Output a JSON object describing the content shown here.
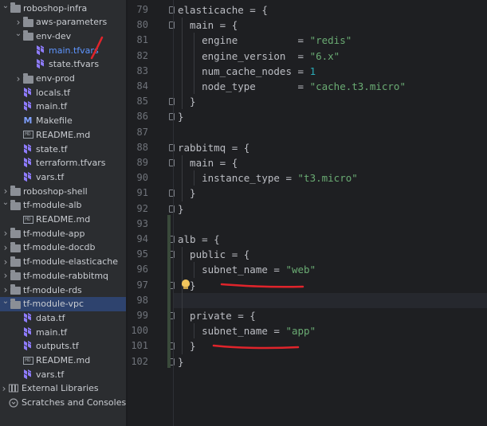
{
  "project_tree": {
    "items": [
      {
        "label": "roboshop-infra",
        "depth": 0,
        "kind": "folder",
        "expanded": true
      },
      {
        "label": "aws-parameters",
        "depth": 1,
        "kind": "folder",
        "expanded": false
      },
      {
        "label": "env-dev",
        "depth": 1,
        "kind": "folder",
        "expanded": true
      },
      {
        "label": "main.tfvars",
        "depth": 2,
        "kind": "terraform",
        "open": true
      },
      {
        "label": "state.tfvars",
        "depth": 2,
        "kind": "terraform"
      },
      {
        "label": "env-prod",
        "depth": 1,
        "kind": "folder",
        "expanded": false
      },
      {
        "label": "locals.tf",
        "depth": 1,
        "kind": "terraform"
      },
      {
        "label": "main.tf",
        "depth": 1,
        "kind": "terraform"
      },
      {
        "label": "Makefile",
        "depth": 1,
        "kind": "makefile"
      },
      {
        "label": "README.md",
        "depth": 1,
        "kind": "markdown"
      },
      {
        "label": "state.tf",
        "depth": 1,
        "kind": "terraform"
      },
      {
        "label": "terraform.tfvars",
        "depth": 1,
        "kind": "terraform"
      },
      {
        "label": "vars.tf",
        "depth": 1,
        "kind": "terraform"
      },
      {
        "label": "roboshop-shell",
        "depth": 0,
        "kind": "folder",
        "expanded": false
      },
      {
        "label": "tf-module-alb",
        "depth": 0,
        "kind": "folder",
        "expanded": true
      },
      {
        "label": "README.md",
        "depth": 1,
        "kind": "markdown"
      },
      {
        "label": "tf-module-app",
        "depth": 0,
        "kind": "folder",
        "expanded": false
      },
      {
        "label": "tf-module-docdb",
        "depth": 0,
        "kind": "folder",
        "expanded": false
      },
      {
        "label": "tf-module-elasticache",
        "depth": 0,
        "kind": "folder",
        "expanded": false
      },
      {
        "label": "tf-module-rabbitmq",
        "depth": 0,
        "kind": "folder",
        "expanded": false
      },
      {
        "label": "tf-module-rds",
        "depth": 0,
        "kind": "folder",
        "expanded": false
      },
      {
        "label": "tf-module-vpc",
        "depth": 0,
        "kind": "folder",
        "expanded": true,
        "selected": true
      },
      {
        "label": "data.tf",
        "depth": 1,
        "kind": "terraform"
      },
      {
        "label": "main.tf",
        "depth": 1,
        "kind": "terraform"
      },
      {
        "label": "outputs.tf",
        "depth": 1,
        "kind": "terraform"
      },
      {
        "label": "README.md",
        "depth": 1,
        "kind": "markdown"
      },
      {
        "label": "vars.tf",
        "depth": 1,
        "kind": "terraform"
      },
      {
        "label": "External Libraries",
        "depth": 0,
        "kind": "library",
        "expanded": false
      },
      {
        "label": "Scratches and Consoles",
        "depth": 0,
        "kind": "scratches"
      }
    ]
  },
  "editor": {
    "current_line": "98",
    "lines": [
      {
        "n": "79",
        "parts": [
          [
            "t",
            "elasticache = {"
          ]
        ]
      },
      {
        "n": "80",
        "parts": [
          [
            "t",
            "  main = {"
          ]
        ]
      },
      {
        "n": "81",
        "parts": [
          [
            "t",
            "    engine          = "
          ],
          [
            "s",
            "\"redis\""
          ]
        ]
      },
      {
        "n": "82",
        "parts": [
          [
            "t",
            "    engine_version  = "
          ],
          [
            "s",
            "\"6.x\""
          ]
        ]
      },
      {
        "n": "83",
        "parts": [
          [
            "t",
            "    num_cache_nodes = "
          ],
          [
            "n",
            "1"
          ]
        ]
      },
      {
        "n": "84",
        "parts": [
          [
            "t",
            "    node_type       = "
          ],
          [
            "s",
            "\"cache.t3.micro\""
          ]
        ]
      },
      {
        "n": "85",
        "parts": [
          [
            "t",
            "  }"
          ]
        ]
      },
      {
        "n": "86",
        "parts": [
          [
            "t",
            "}"
          ]
        ]
      },
      {
        "n": "87",
        "parts": []
      },
      {
        "n": "88",
        "parts": [
          [
            "t",
            "rabbitmq = {"
          ]
        ]
      },
      {
        "n": "89",
        "parts": [
          [
            "t",
            "  main = {"
          ]
        ]
      },
      {
        "n": "90",
        "parts": [
          [
            "t",
            "    instance_type = "
          ],
          [
            "s",
            "\"t3.micro\""
          ]
        ]
      },
      {
        "n": "91",
        "parts": [
          [
            "t",
            "  }"
          ]
        ]
      },
      {
        "n": "92",
        "parts": [
          [
            "t",
            "}"
          ]
        ]
      },
      {
        "n": "93",
        "parts": []
      },
      {
        "n": "94",
        "parts": [
          [
            "t",
            "alb = {"
          ]
        ]
      },
      {
        "n": "95",
        "parts": [
          [
            "t",
            "  public = {"
          ]
        ]
      },
      {
        "n": "96",
        "parts": [
          [
            "t",
            "    subnet_name = "
          ],
          [
            "s",
            "\"web\""
          ]
        ]
      },
      {
        "n": "97",
        "parts": [
          [
            "t",
            "  }"
          ]
        ]
      },
      {
        "n": "98",
        "parts": []
      },
      {
        "n": "99",
        "parts": [
          [
            "t",
            "  private = {"
          ]
        ]
      },
      {
        "n": "100",
        "parts": [
          [
            "t",
            "    subnet_name = "
          ],
          [
            "s",
            "\"app\""
          ]
        ]
      },
      {
        "n": "101",
        "parts": [
          [
            "t",
            "  }"
          ]
        ]
      },
      {
        "n": "102",
        "parts": [
          [
            "t",
            "}"
          ]
        ]
      }
    ]
  },
  "colors": {
    "keyword_text": "#bcbec4",
    "string": "#6aab73",
    "number": "#2aacb8",
    "annotation_ink": "#e0242b",
    "selection": "#2e436e"
  }
}
